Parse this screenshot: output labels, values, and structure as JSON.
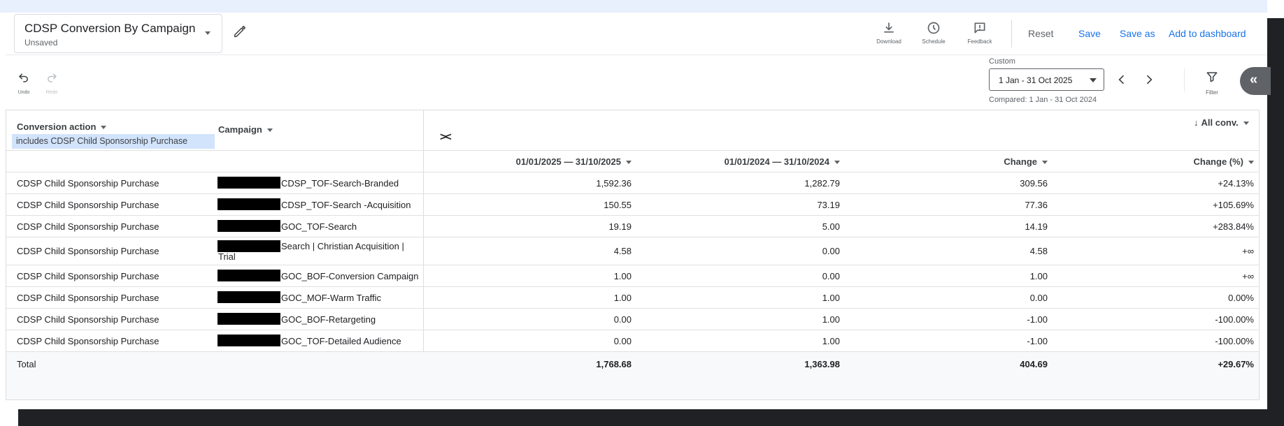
{
  "report": {
    "title": "CDSP Conversion By Campaign",
    "subtitle": "Unsaved"
  },
  "toolbar": {
    "download": "Download",
    "schedule": "Schedule",
    "feedback": "Feedback",
    "reset": "Reset",
    "save": "Save",
    "save_as": "Save as",
    "add_to_dashboard": "Add to dashboard",
    "undo": "Undo",
    "redo": "Redo",
    "filter": "Filter"
  },
  "date": {
    "label": "Custom",
    "range": "1 Jan - 31 Oct 2025",
    "compared": "Compared: 1 Jan - 31 Oct 2024"
  },
  "table": {
    "conversion_action_header": "Conversion action",
    "filter_chip": "includes CDSP Child Sponsorship Purchase",
    "campaign_header": "Campaign",
    "metric": "All conv.",
    "col_2025": "01/01/2025 — 31/10/2025",
    "col_2024": "01/01/2024 — 31/10/2024",
    "col_change": "Change",
    "col_change_pct": "Change (%)",
    "rows": [
      {
        "action": "CDSP Child Sponsorship Purchase",
        "campaign": "CDSP_TOF-Search-Branded",
        "v2025": "1,592.36",
        "v2024": "1,282.79",
        "change": "309.56",
        "pct": "+24.13%"
      },
      {
        "action": "CDSP Child Sponsorship Purchase",
        "campaign": "CDSP_TOF-Search -Acquisition",
        "v2025": "150.55",
        "v2024": "73.19",
        "change": "77.36",
        "pct": "+105.69%"
      },
      {
        "action": "CDSP Child Sponsorship Purchase",
        "campaign": "GOC_TOF-Search",
        "v2025": "19.19",
        "v2024": "5.00",
        "change": "14.19",
        "pct": "+283.84%"
      },
      {
        "action": "CDSP Child Sponsorship Purchase",
        "campaign": "Search | Christian Acquisition |",
        "campaign_line2": "Trial",
        "v2025": "4.58",
        "v2024": "0.00",
        "change": "4.58",
        "pct": "+∞"
      },
      {
        "action": "CDSP Child Sponsorship Purchase",
        "campaign": "GOC_BOF-Conversion Campaign",
        "v2025": "1.00",
        "v2024": "0.00",
        "change": "1.00",
        "pct": "+∞"
      },
      {
        "action": "CDSP Child Sponsorship Purchase",
        "campaign": "GOC_MOF-Warm Traffic",
        "v2025": "1.00",
        "v2024": "1.00",
        "change": "0.00",
        "pct": "0.00%"
      },
      {
        "action": "CDSP Child Sponsorship Purchase",
        "campaign": "GOC_BOF-Retargeting",
        "v2025": "0.00",
        "v2024": "1.00",
        "change": "-1.00",
        "pct": "-100.00%"
      },
      {
        "action": "CDSP Child Sponsorship Purchase",
        "campaign": "GOC_TOF-Detailed Audience",
        "v2025": "0.00",
        "v2024": "1.00",
        "change": "-1.00",
        "pct": "-100.00%"
      }
    ],
    "total": {
      "label": "Total",
      "v2025": "1,768.68",
      "v2024": "1,363.98",
      "change": "404.69",
      "pct": "+29.67%"
    }
  }
}
